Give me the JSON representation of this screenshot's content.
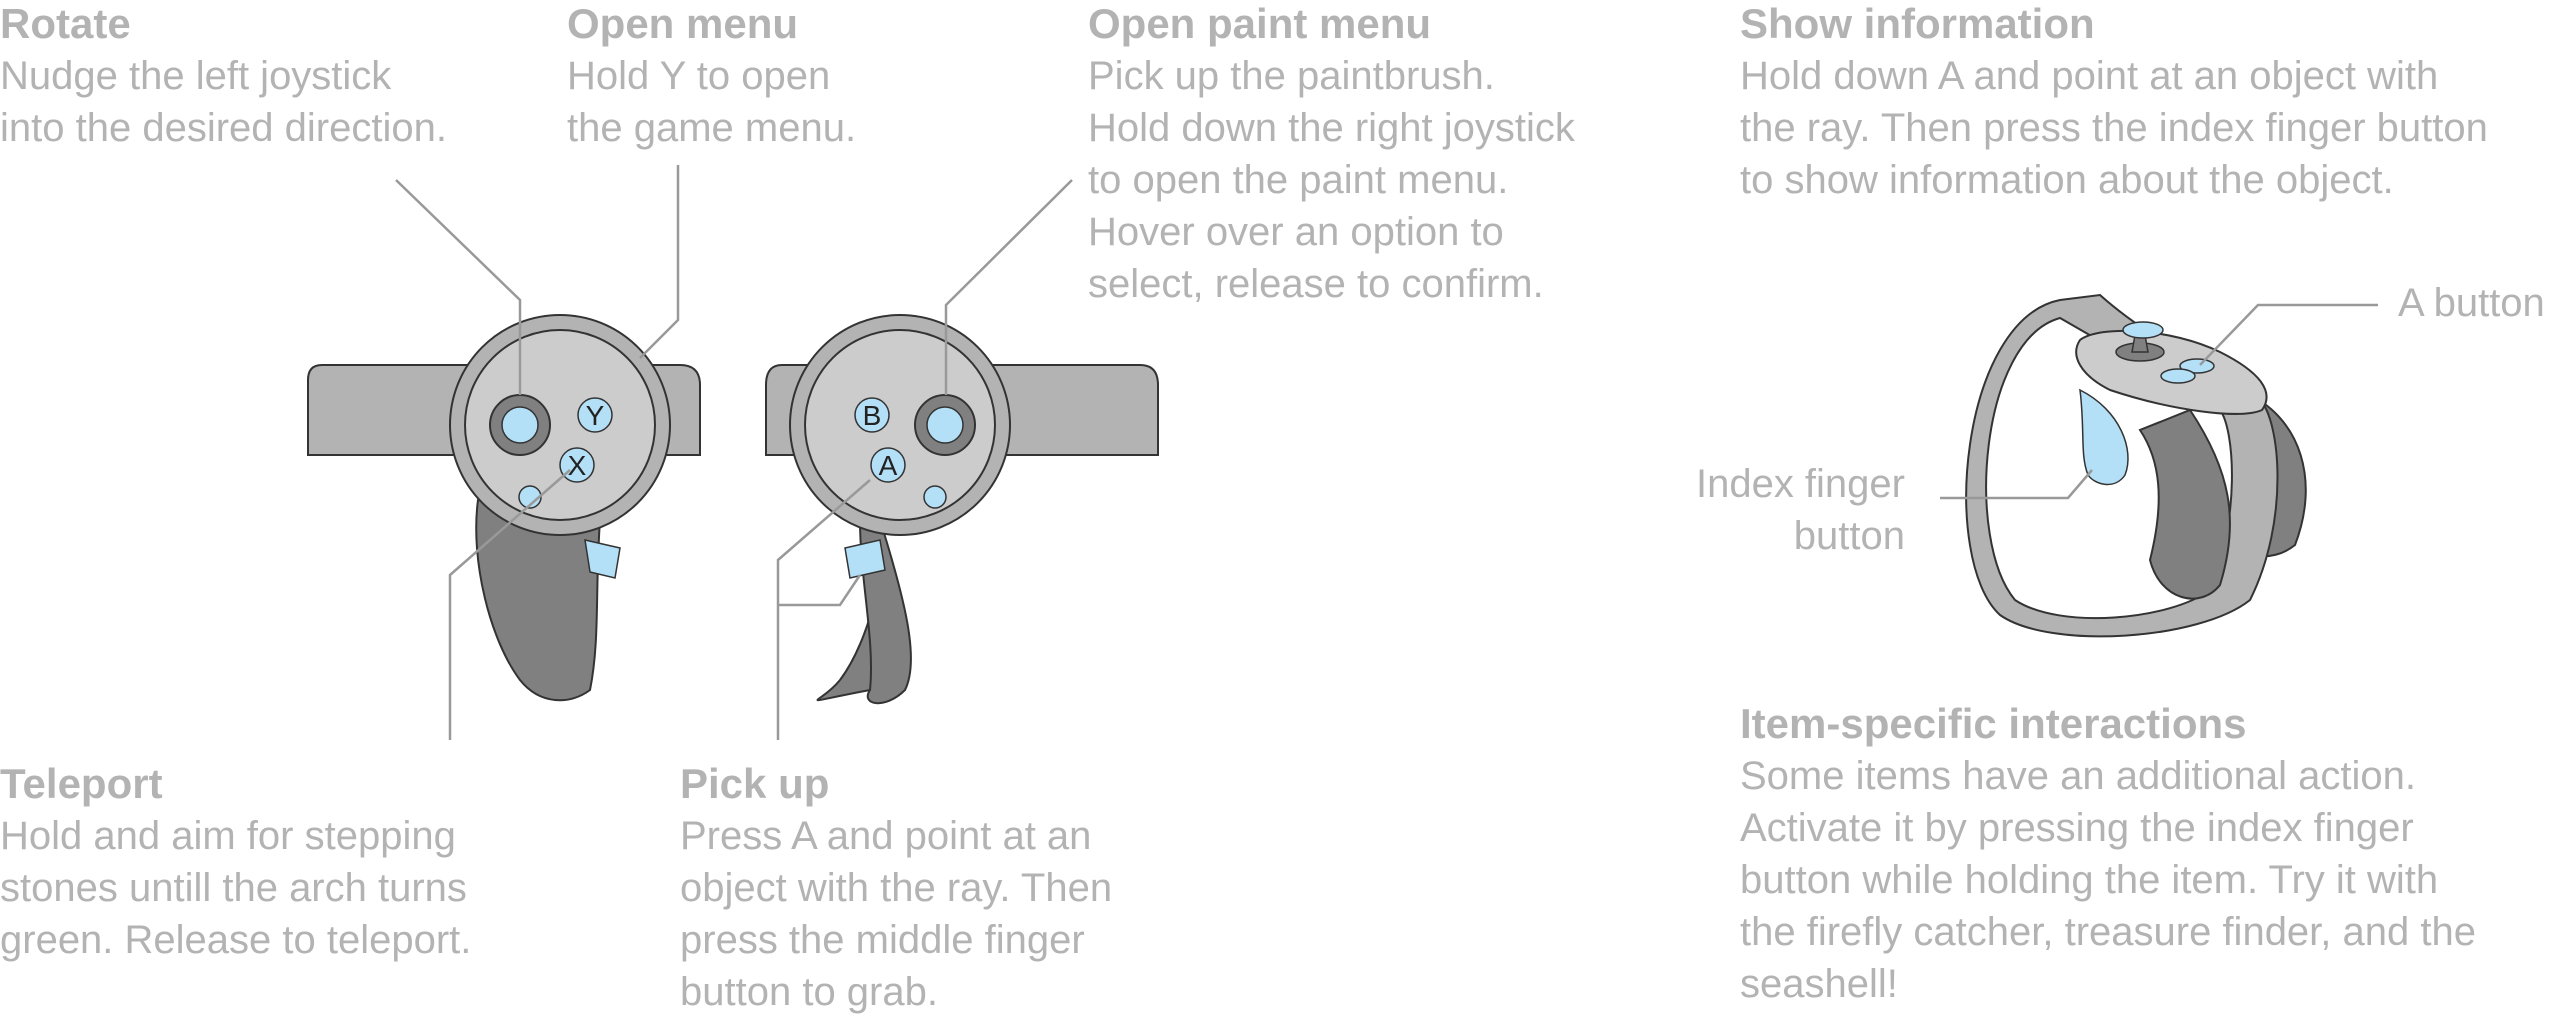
{
  "callouts": {
    "rotate": {
      "title": "Rotate",
      "lines": [
        "Nudge the left joystick",
        "into the desired direction."
      ]
    },
    "open_menu": {
      "title": "Open menu",
      "lines": [
        "Hold Y to open",
        "the game menu."
      ]
    },
    "open_paint_menu": {
      "title": "Open paint menu",
      "lines": [
        "Pick up the paintbrush.",
        "Hold down the right joystick",
        "to open the paint menu.",
        "Hover over an option to",
        "select, release to confirm."
      ]
    },
    "show_information": {
      "title": "Show information",
      "lines": [
        "Hold down A and point at an object with",
        "the ray. Then press the index finger button",
        "to show information about the object."
      ]
    },
    "teleport": {
      "title": "Teleport",
      "lines": [
        "Hold and aim for stepping",
        "stones untill the arch turns",
        "green. Release to teleport."
      ]
    },
    "pick_up": {
      "title": "Pick up",
      "lines": [
        "Press A and point at an",
        "object with the ray. Then",
        "press the middle finger",
        "button to grab."
      ]
    },
    "item_specific": {
      "title": "Item-specific interactions",
      "lines": [
        "Some items have an additional action.",
        "Activate it by pressing the index finger",
        "button while holding the item. Try it with",
        "the firefly catcher, treasure finder, and the",
        "seashell!"
      ]
    }
  },
  "labels": {
    "a_button": "A button",
    "index_finger_button": [
      "Index finger",
      "button"
    ]
  },
  "buttons": {
    "y": "Y",
    "x": "X",
    "b": "B",
    "a": "A"
  },
  "colors": {
    "text": "#b3b3b3",
    "controller_light": "#cccccc",
    "controller_mid": "#b3b3b3",
    "controller_dark": "#808080",
    "button_accent": "#b3e0f7",
    "leader_line": "#999999"
  }
}
